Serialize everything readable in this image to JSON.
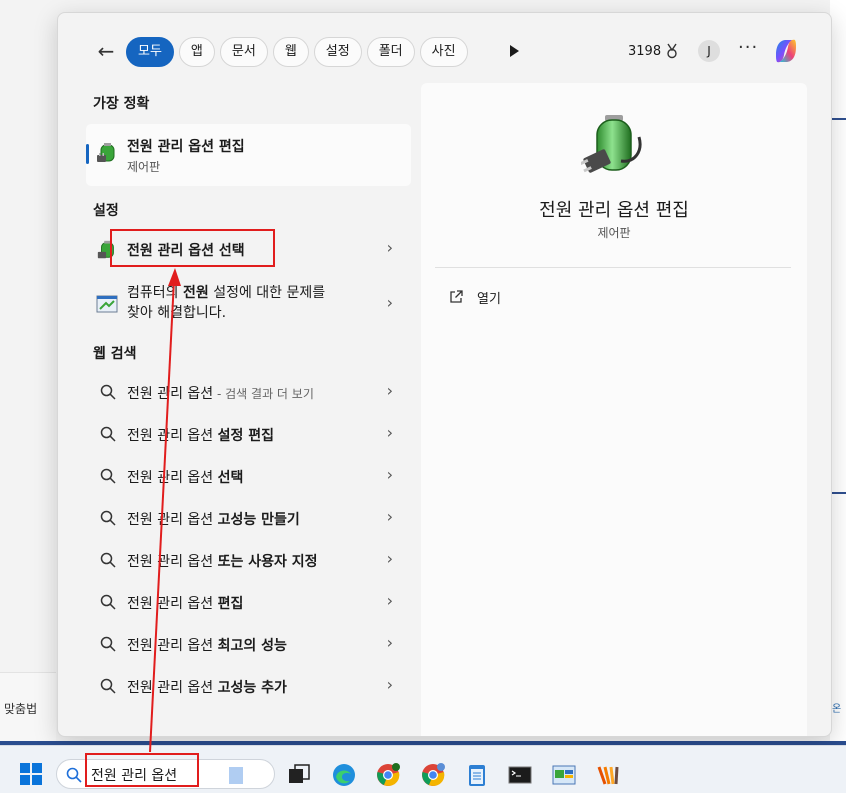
{
  "topbar": {
    "back_label": "←",
    "chips": [
      "모두",
      "앱",
      "문서",
      "웹",
      "설정",
      "폴더",
      "사진"
    ],
    "points": "3198",
    "avatar_letter": "J",
    "more_label": "···"
  },
  "best_match": {
    "section_title": "가장 정확",
    "title": "전원 관리 옵션 편집",
    "subtitle": "제어판"
  },
  "settings": {
    "section_title": "설정",
    "items": [
      {
        "label": "전원 관리 옵션 선택"
      },
      {
        "label_line1_pre": "컴퓨터의 ",
        "label_line1_bold": "전원",
        "label_line1_post": " 설정에 대한 문제를",
        "label_line2": "찾아 해결합니다."
      }
    ]
  },
  "web_search": {
    "section_title": "웹 검색",
    "items": [
      {
        "base": "전원 관리 옵션",
        "suffix": " - 검색 결과 더 보기",
        "bold": ""
      },
      {
        "base": "전원 관리 옵션 ",
        "suffix": "",
        "bold": "설정 편집"
      },
      {
        "base": "전원 관리 옵션 ",
        "suffix": "",
        "bold": "선택"
      },
      {
        "base": "전원 관리 옵션 ",
        "suffix": "",
        "bold": "고성능 만들기"
      },
      {
        "base": "전원 관리 옵션 ",
        "suffix": "",
        "bold": "또는 사용자 지정"
      },
      {
        "base": "전원 관리 옵션 ",
        "suffix": "",
        "bold": "편집"
      },
      {
        "base": "전원 관리 옵션 ",
        "suffix": "",
        "bold": "최고의 성능"
      },
      {
        "base": "전원 관리 옵션 ",
        "suffix": "",
        "bold": "고성능 추가"
      }
    ]
  },
  "preview": {
    "title": "전원 관리 옵션 편집",
    "subtitle": "제어판",
    "open_label": "열기"
  },
  "taskbar": {
    "search_value": "전원 관리 옵션"
  },
  "background": {
    "left_text": "맞춤법",
    "right_text": "온"
  },
  "colors": {
    "accent": "#1565c0",
    "annotation_red": "#e11d1d"
  }
}
